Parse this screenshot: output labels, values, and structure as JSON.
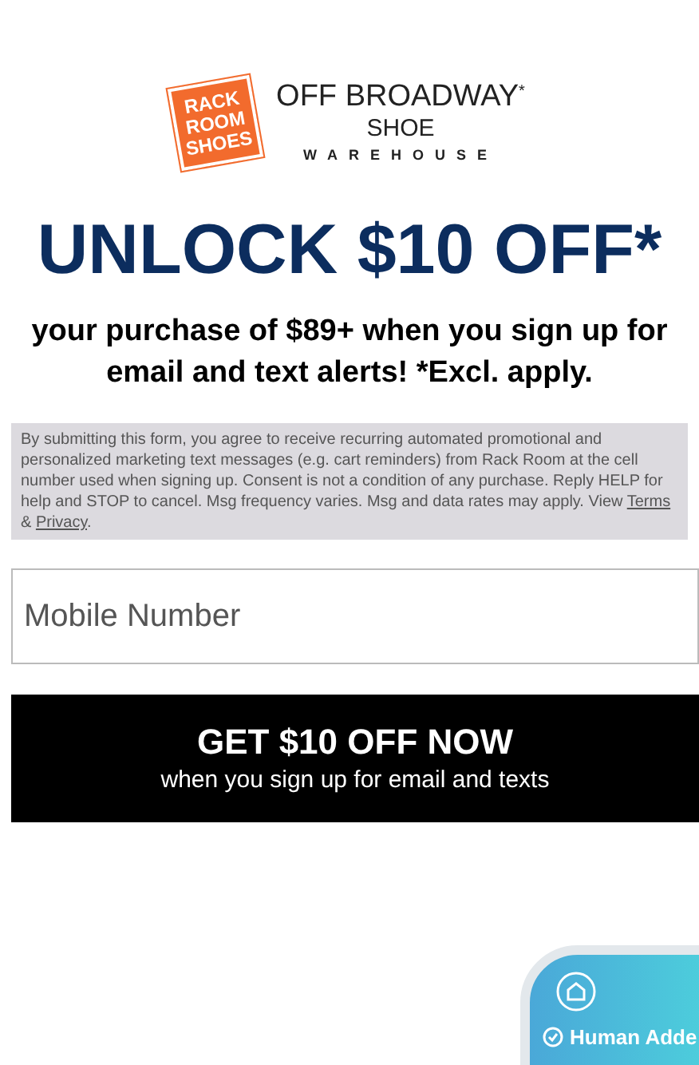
{
  "logo": {
    "badge_lines": [
      "RACK",
      "ROOM",
      "SHOES"
    ],
    "brand": "OFF BROADWAY",
    "brand_mark": "*",
    "sub": "SHOE",
    "sub2": "WAREHOUSE"
  },
  "headline": "UNLOCK $10 OFF*",
  "subhead": "your purchase of $89+ when you sign up for email and text alerts! *Excl. apply.",
  "disclaimer": {
    "text": "By submitting this form, you agree to receive recurring automated promotional and personalized marketing text messages (e.g. cart reminders) from Rack Room at the cell number used when signing up. Consent is not a condition of any purchase. Reply HELP for help and STOP to cancel. Msg frequency varies. Msg and data rates may apply. View",
    "links": [
      "Terms",
      "Privacy"
    ],
    "joiner": "&",
    "end": "."
  },
  "phone_field": {
    "placeholder": "Mobile Number"
  },
  "submit_button": {
    "label": "GET $10 OFF NOW",
    "sublabel": "when you sign up for email and texts"
  },
  "badge": {
    "label": "Human Adde"
  }
}
